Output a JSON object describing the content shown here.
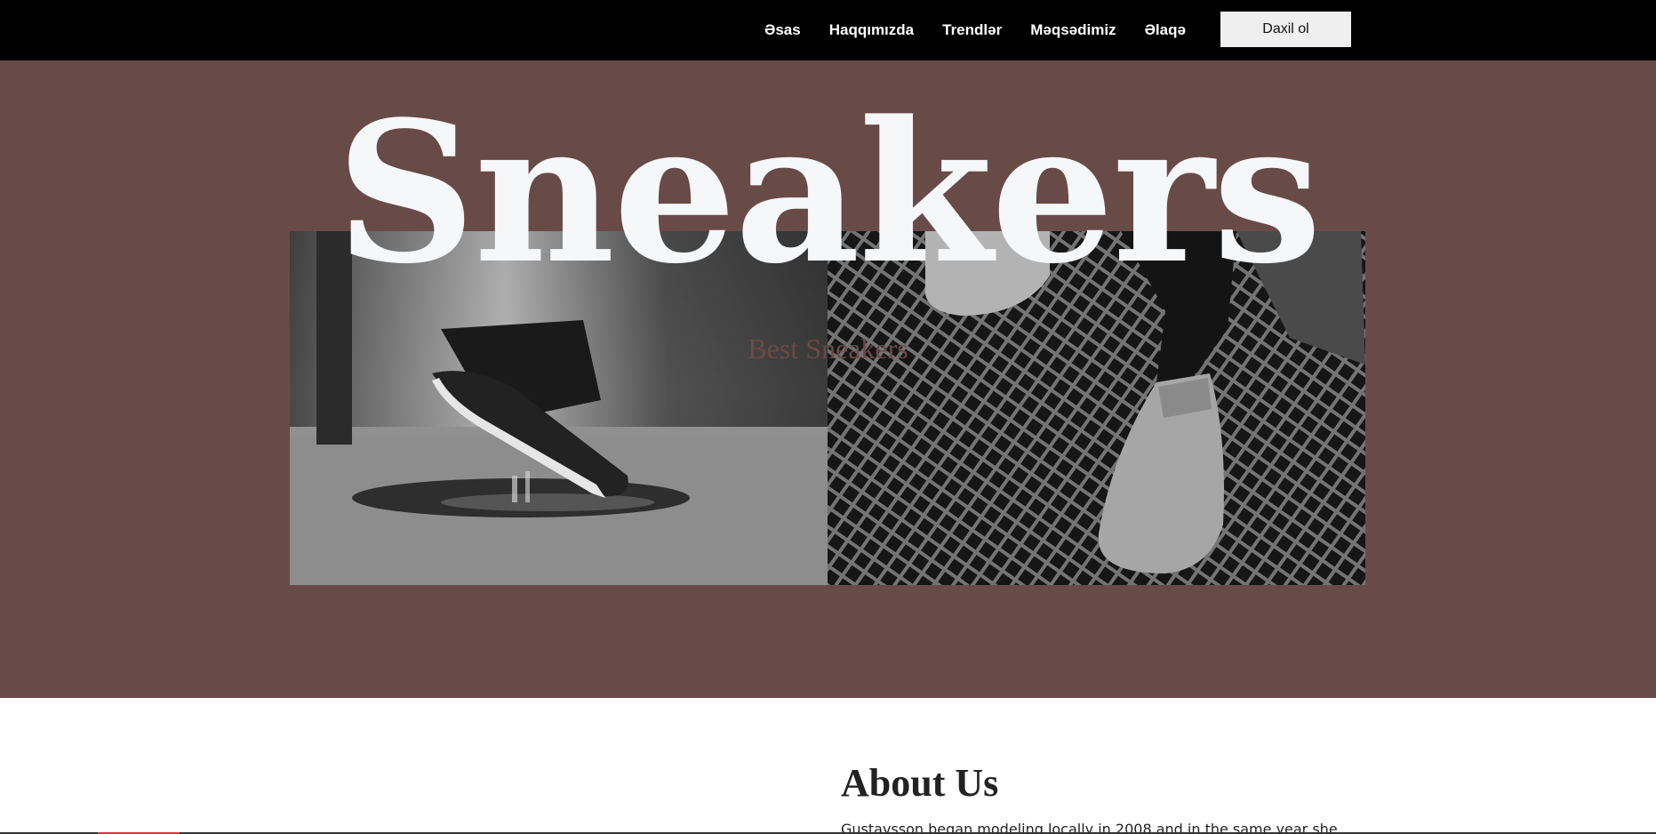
{
  "nav": {
    "links": [
      "Əsas",
      "Haqqımızda",
      "Trendlər",
      "Məqsədimiz",
      "Əlaqə"
    ],
    "login_label": "Daxil ol"
  },
  "hero": {
    "title": "Sneakers",
    "subtitle": "Best Sneakers",
    "photos": [
      "black-sneaker-splashing-puddle",
      "white-sneakers-on-metal-grate"
    ]
  },
  "about": {
    "title": "About Us",
    "text": "Gustavsson began modeling locally in 2008 and in the same year she"
  },
  "colors": {
    "navbar": "#000000",
    "hero_bg": "#684b47",
    "title": "#f6f7f9",
    "subtitle": "#6b4a45",
    "button_bg": "#efefef"
  }
}
